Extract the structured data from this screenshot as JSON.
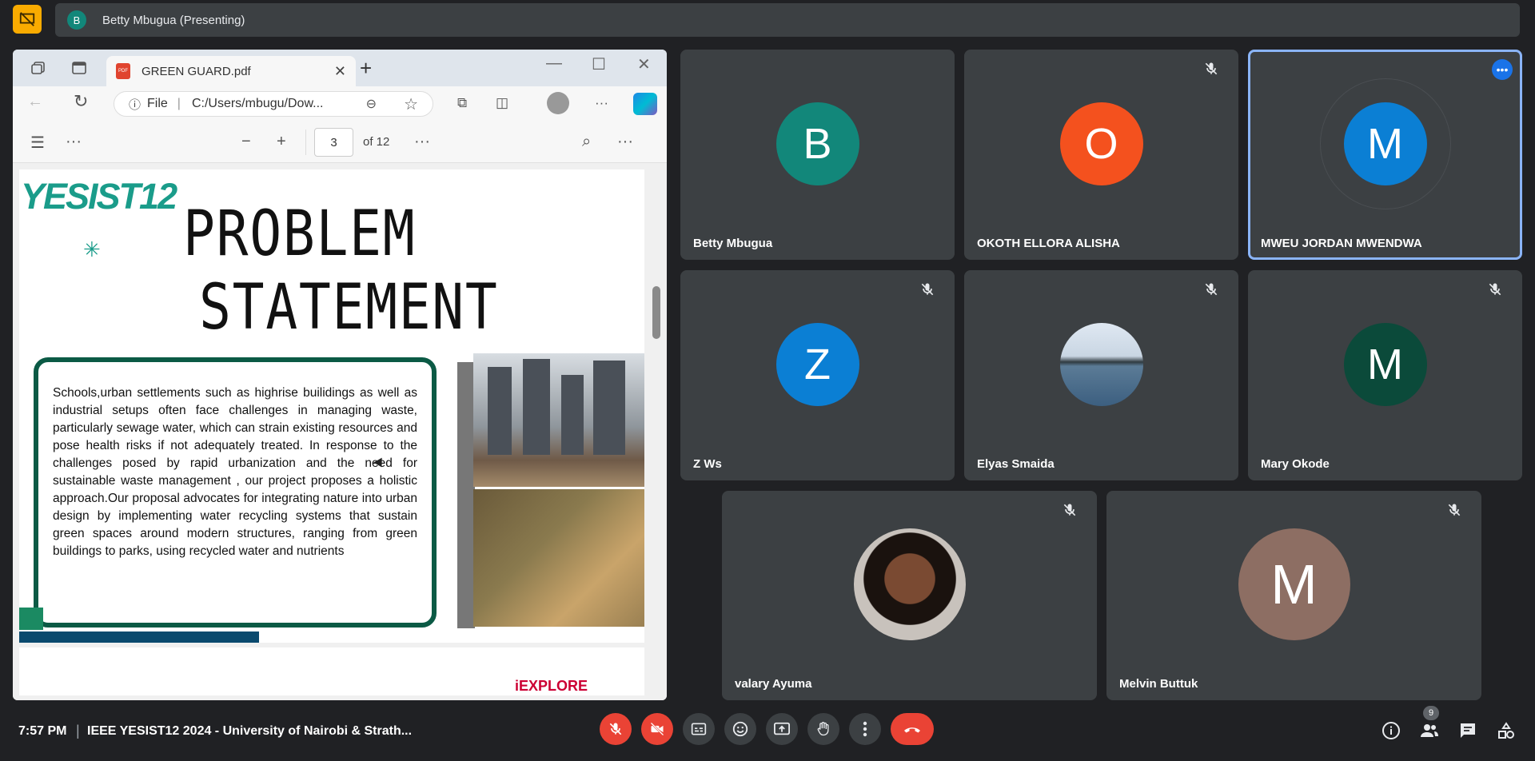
{
  "topbar": {
    "presenter_initial": "B",
    "presenter_label": "Betty Mbugua (Presenting)"
  },
  "browser": {
    "tab_title": "GREEN GUARD.pdf",
    "url_prefix": "File",
    "url": "C:/Users/mbugu/Dow...",
    "pdf_icon_text": "PDF"
  },
  "pdf_toolbar": {
    "current_page": "3",
    "page_of": "of 12"
  },
  "slide": {
    "logo": "YESIST12",
    "title_line1": "PROBLEM",
    "title_line2": "STATEMENT",
    "body": "Schools,urban settlements such as highrise builidings as well as industrial setups often face challenges in managing waste, particularly sewage water, which can strain existing resources and pose health risks if not adequately treated. In response to the challenges posed by rapid urbanization and the need for sustainable waste management , our project proposes a holistic approach.Our proposal advocates for integrating nature into urban design by implementing water recycling systems that sustain green spaces around modern structures, ranging from green buildings to parks, using recycled water and nutrients",
    "next_page_logo": "iEXPLORE"
  },
  "participants": [
    {
      "name": "Betty Mbugua",
      "initial": "B",
      "color": "#12877a",
      "muted": false,
      "type": "letter"
    },
    {
      "name": "OKOTH ELLORA ALISHA",
      "initial": "O",
      "color": "#f4511e",
      "muted": true,
      "type": "letter"
    },
    {
      "name": "MWEU JORDAN MWENDWA",
      "initial": "M",
      "color": "#0b7fd4",
      "muted": false,
      "type": "letter",
      "active_speaker": true
    },
    {
      "name": "Z Ws",
      "initial": "Z",
      "color": "#0b7fd4",
      "muted": true,
      "type": "letter"
    },
    {
      "name": "Elyas Smaida",
      "initial": "",
      "color": "#6a8caf",
      "muted": true,
      "type": "photo-sea"
    },
    {
      "name": "Mary Okode",
      "initial": "M",
      "color": "#0b4a3a",
      "muted": true,
      "type": "letter"
    },
    {
      "name": "valary Ayuma",
      "initial": "",
      "color": "#5b3a2a",
      "muted": true,
      "type": "photo-person"
    },
    {
      "name": "Melvin Buttuk",
      "initial": "M",
      "color": "#8d6e63",
      "muted": true,
      "type": "letter"
    }
  ],
  "bottombar": {
    "time": "7:57 PM",
    "separator": "|",
    "meeting_title": "IEEE YESIST12 2024 - University of Nairobi & Strath...",
    "participant_count": "9"
  },
  "colors": {
    "background": "#202124",
    "tile": "#3c4043",
    "danger": "#ea4335",
    "active_border": "#8ab4f8"
  }
}
